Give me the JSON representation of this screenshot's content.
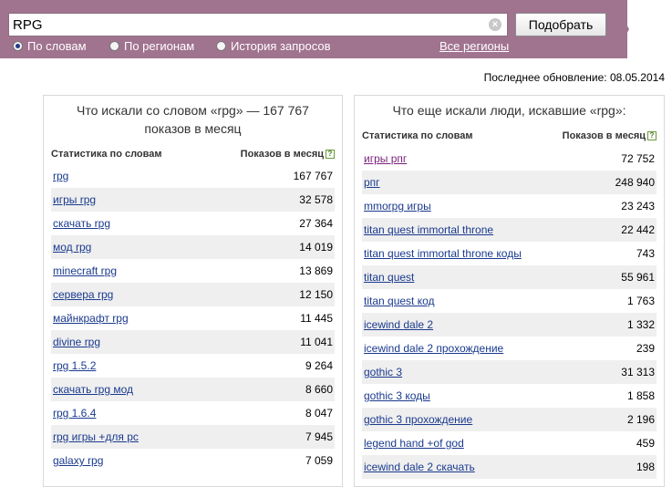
{
  "search": {
    "value": "RPG",
    "button_label": "Подобрать"
  },
  "modes": [
    {
      "label": "По словам",
      "checked": true
    },
    {
      "label": "По регионам",
      "checked": false
    },
    {
      "label": "История запросов",
      "checked": false
    }
  ],
  "regions_link": "Все регионы",
  "last_update": "Последнее обновление: 08.05.2014",
  "left_panel": {
    "title_line1": "Что искали со словом «rpg» — 167 767",
    "title_line2": "показов в месяц",
    "col_keyword": "Статистика по словам",
    "col_count": "Показов в месяц",
    "help_icon": "?",
    "rows": [
      {
        "keyword": "rpg",
        "count": "167 767"
      },
      {
        "keyword": "игры rpg",
        "count": "32 578"
      },
      {
        "keyword": "скачать rpg",
        "count": "27 364"
      },
      {
        "keyword": "мод rpg",
        "count": "14 019"
      },
      {
        "keyword": "minecraft rpg",
        "count": "13 869"
      },
      {
        "keyword": "сервера rpg",
        "count": "12 150"
      },
      {
        "keyword": "майнкрафт rpg",
        "count": "11 445"
      },
      {
        "keyword": "divine rpg",
        "count": "11 041"
      },
      {
        "keyword": "rpg 1.5.2",
        "count": "9 264"
      },
      {
        "keyword": "скачать rpg мод",
        "count": "8 660"
      },
      {
        "keyword": "rpg 1.6.4",
        "count": "8 047"
      },
      {
        "keyword": "rpg игры +для pc",
        "count": "7 945"
      },
      {
        "keyword": "galaxy rpg",
        "count": "7 059"
      }
    ]
  },
  "right_panel": {
    "title": "Что еще искали люди, искавшие «rpg»:",
    "col_keyword": "Статистика по словам",
    "col_count": "Показов в месяц",
    "help_icon": "?",
    "rows": [
      {
        "keyword": "игры рпг",
        "count": "72 752",
        "visited": true
      },
      {
        "keyword": "рпг",
        "count": "248 940"
      },
      {
        "keyword": "mmorpg игры",
        "count": "23 243"
      },
      {
        "keyword": "titan quest immortal throne",
        "count": "22 442"
      },
      {
        "keyword": "titan quest immortal throne коды",
        "count": "743"
      },
      {
        "keyword": "titan quest",
        "count": "55 961"
      },
      {
        "keyword": "titan quest код",
        "count": "1 763"
      },
      {
        "keyword": "icewind dale 2",
        "count": "1 332"
      },
      {
        "keyword": "icewind dale 2 прохождение",
        "count": "239"
      },
      {
        "keyword": "gothic 3",
        "count": "31 313"
      },
      {
        "keyword": "gothic 3 коды",
        "count": "1 858"
      },
      {
        "keyword": "gothic 3 прохождение",
        "count": "2 196"
      },
      {
        "keyword": "legend hand +of god",
        "count": "459"
      },
      {
        "keyword": "icewind dale 2 скачать",
        "count": "198"
      }
    ]
  }
}
